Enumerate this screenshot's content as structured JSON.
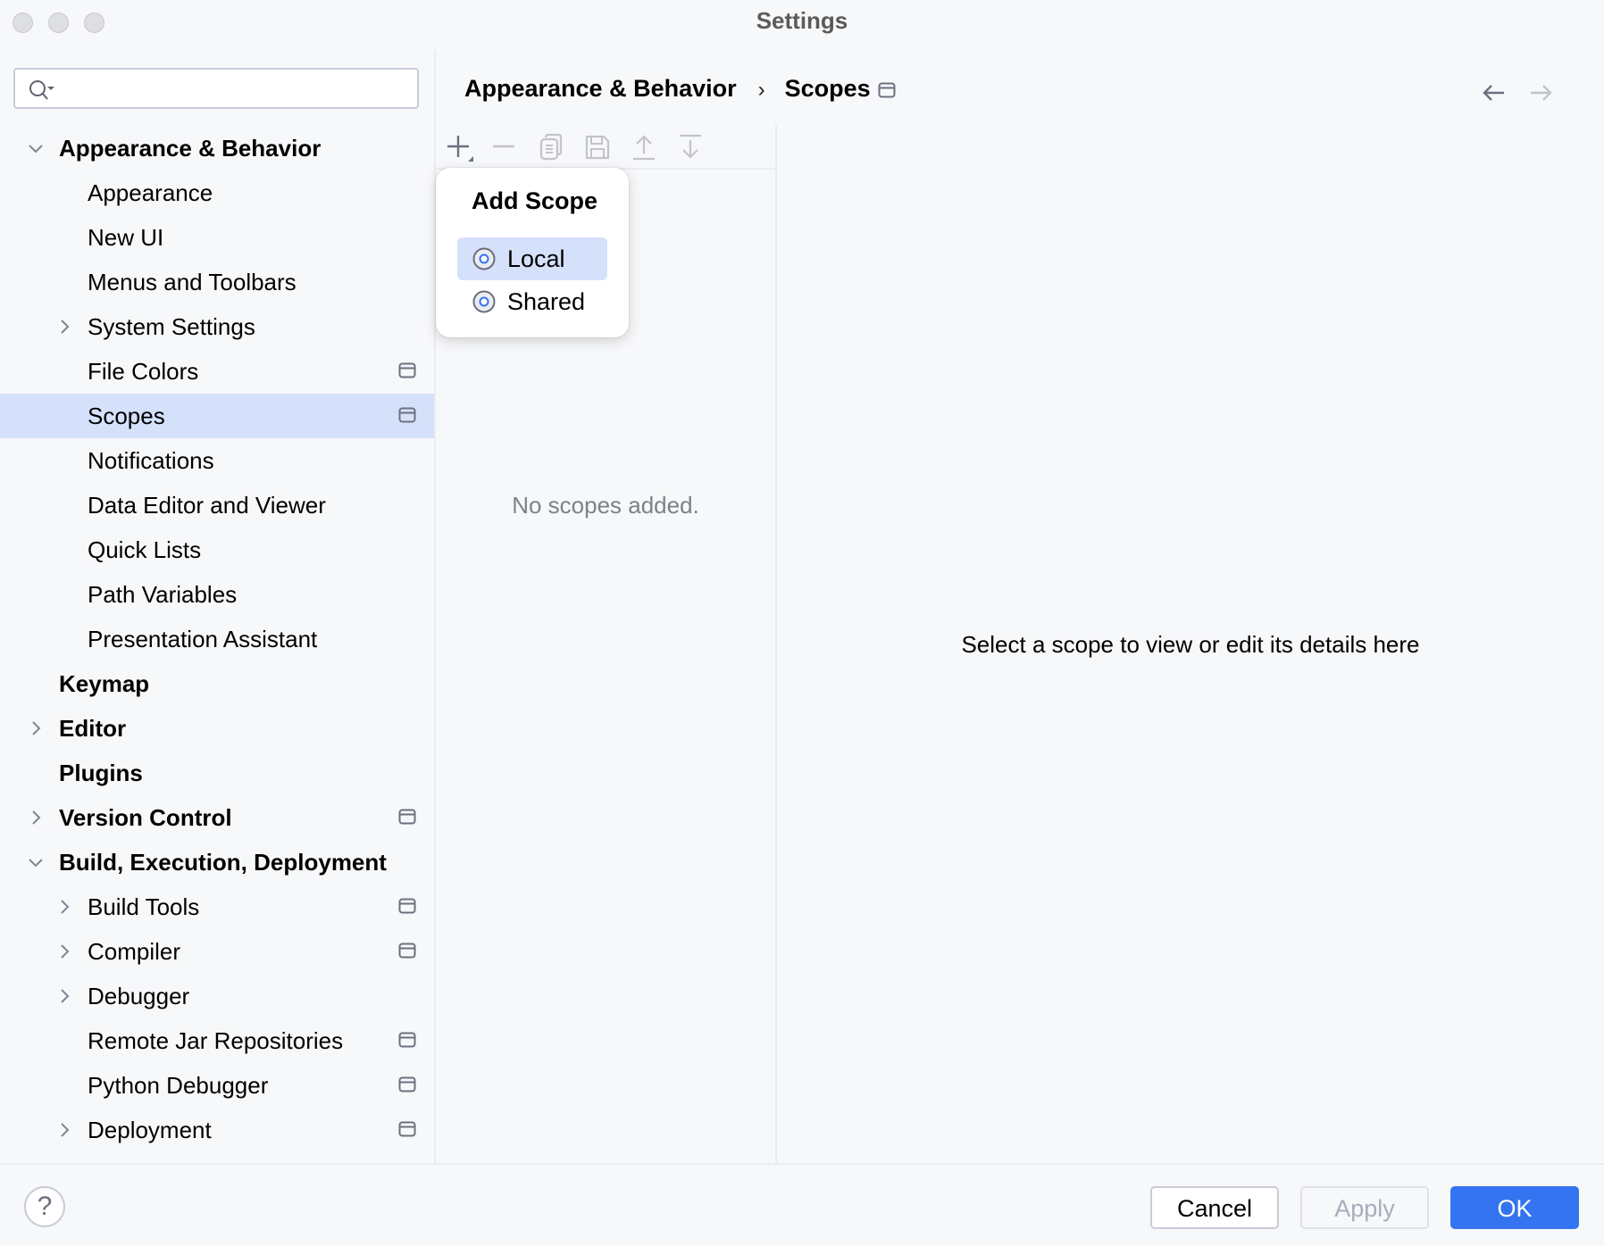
{
  "window": {
    "title": "Settings"
  },
  "search": {
    "placeholder": "",
    "value": ""
  },
  "sidebar": {
    "items": [
      {
        "label": "Appearance & Behavior",
        "level": 0,
        "bold": true,
        "expander": "expanded",
        "project_icon": false,
        "selected": false
      },
      {
        "label": "Appearance",
        "level": 1,
        "bold": false,
        "expander": "none",
        "project_icon": false,
        "selected": false
      },
      {
        "label": "New UI",
        "level": 1,
        "bold": false,
        "expander": "none",
        "project_icon": false,
        "selected": false
      },
      {
        "label": "Menus and Toolbars",
        "level": 1,
        "bold": false,
        "expander": "none",
        "project_icon": false,
        "selected": false
      },
      {
        "label": "System Settings",
        "level": 1,
        "bold": false,
        "expander": "collapsed",
        "project_icon": false,
        "selected": false
      },
      {
        "label": "File Colors",
        "level": 1,
        "bold": false,
        "expander": "none",
        "project_icon": true,
        "selected": false
      },
      {
        "label": "Scopes",
        "level": 1,
        "bold": false,
        "expander": "none",
        "project_icon": true,
        "selected": true
      },
      {
        "label": "Notifications",
        "level": 1,
        "bold": false,
        "expander": "none",
        "project_icon": false,
        "selected": false
      },
      {
        "label": "Data Editor and Viewer",
        "level": 1,
        "bold": false,
        "expander": "none",
        "project_icon": false,
        "selected": false
      },
      {
        "label": "Quick Lists",
        "level": 1,
        "bold": false,
        "expander": "none",
        "project_icon": false,
        "selected": false
      },
      {
        "label": "Path Variables",
        "level": 1,
        "bold": false,
        "expander": "none",
        "project_icon": false,
        "selected": false
      },
      {
        "label": "Presentation Assistant",
        "level": 1,
        "bold": false,
        "expander": "none",
        "project_icon": false,
        "selected": false
      },
      {
        "label": "Keymap",
        "level": 0,
        "bold": true,
        "expander": "none",
        "project_icon": false,
        "selected": false
      },
      {
        "label": "Editor",
        "level": 0,
        "bold": true,
        "expander": "collapsed",
        "project_icon": false,
        "selected": false
      },
      {
        "label": "Plugins",
        "level": 0,
        "bold": true,
        "expander": "none",
        "project_icon": false,
        "selected": false
      },
      {
        "label": "Version Control",
        "level": 0,
        "bold": true,
        "expander": "collapsed",
        "project_icon": true,
        "selected": false
      },
      {
        "label": "Build, Execution, Deployment",
        "level": 0,
        "bold": true,
        "expander": "expanded",
        "project_icon": false,
        "selected": false
      },
      {
        "label": "Build Tools",
        "level": 1,
        "bold": false,
        "expander": "collapsed",
        "project_icon": true,
        "selected": false
      },
      {
        "label": "Compiler",
        "level": 1,
        "bold": false,
        "expander": "collapsed",
        "project_icon": true,
        "selected": false
      },
      {
        "label": "Debugger",
        "level": 1,
        "bold": false,
        "expander": "collapsed",
        "project_icon": false,
        "selected": false
      },
      {
        "label": "Remote Jar Repositories",
        "level": 1,
        "bold": false,
        "expander": "none",
        "project_icon": true,
        "selected": false
      },
      {
        "label": "Python Debugger",
        "level": 1,
        "bold": false,
        "expander": "none",
        "project_icon": true,
        "selected": false
      },
      {
        "label": "Deployment",
        "level": 1,
        "bold": false,
        "expander": "collapsed",
        "project_icon": true,
        "selected": false
      }
    ]
  },
  "header": {
    "breadcrumb": [
      "Appearance & Behavior",
      "Scopes"
    ],
    "separator": "›",
    "back_enabled": true,
    "forward_enabled": false
  },
  "toolbar": {
    "buttons": [
      {
        "name": "add",
        "icon": "plus-icon",
        "enabled": true
      },
      {
        "name": "remove",
        "icon": "minus-icon",
        "enabled": false
      },
      {
        "name": "copy",
        "icon": "copy-icon",
        "enabled": false
      },
      {
        "name": "save",
        "icon": "save-icon",
        "enabled": false
      },
      {
        "name": "move-up",
        "icon": "arrow-up-icon",
        "enabled": false
      },
      {
        "name": "move-down",
        "icon": "arrow-down-icon",
        "enabled": false
      }
    ]
  },
  "scopes_list": {
    "empty_text": "No scopes added."
  },
  "details": {
    "placeholder_text": "Select a scope to view or edit its details here"
  },
  "popup": {
    "title": "Add Scope",
    "items": [
      {
        "label": "Local",
        "highlighted": true
      },
      {
        "label": "Shared",
        "highlighted": false
      }
    ]
  },
  "footer": {
    "help_label": "?",
    "cancel_label": "Cancel",
    "apply_label": "Apply",
    "ok_label": "OK",
    "apply_enabled": false
  },
  "colors": {
    "accent": "#3574f0",
    "selection": "#d5e1fb",
    "background": "#f7f8fa"
  }
}
